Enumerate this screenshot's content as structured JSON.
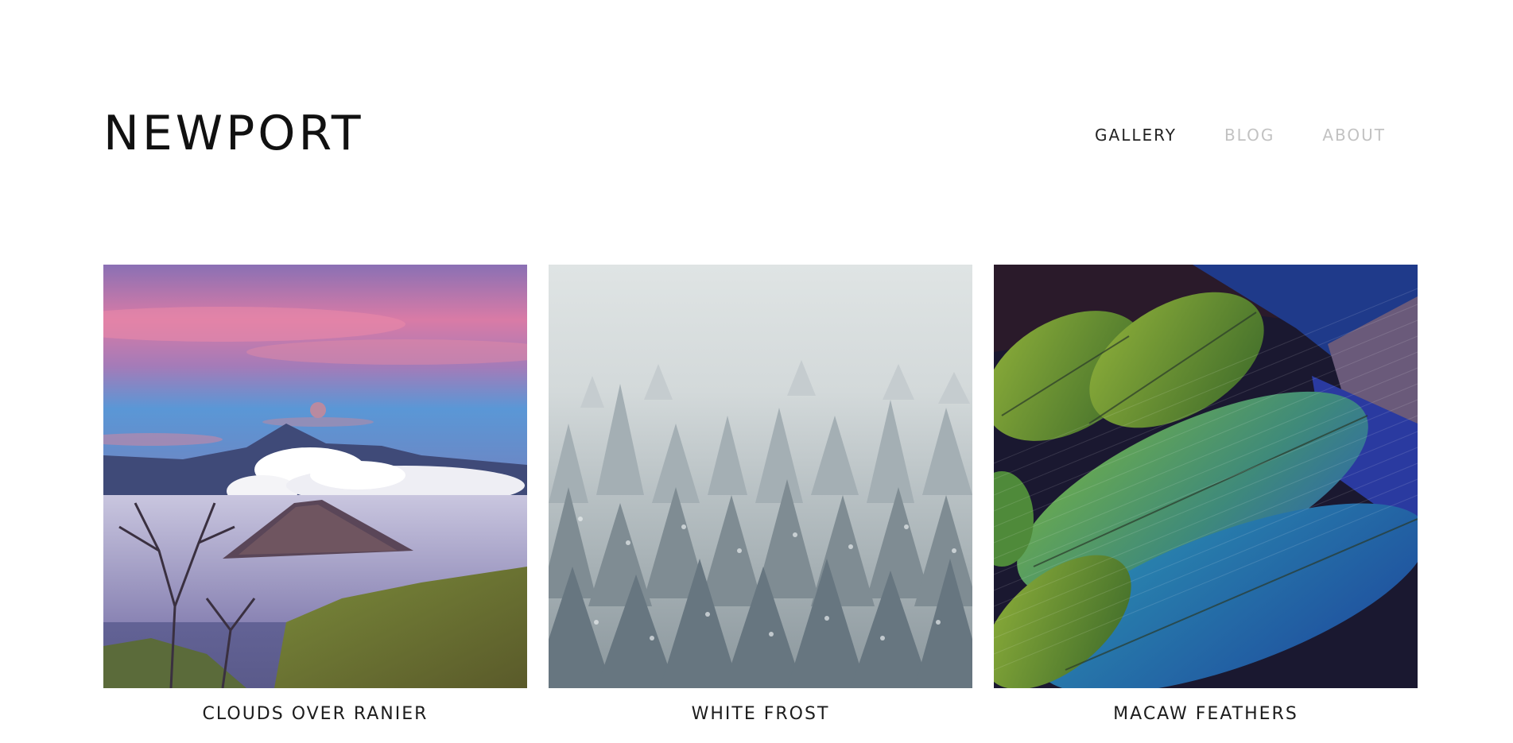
{
  "header": {
    "brand": "NEWPORT",
    "nav": [
      {
        "label": "GALLERY",
        "active": true
      },
      {
        "label": "BLOG",
        "active": false
      },
      {
        "label": "ABOUT",
        "active": false
      }
    ]
  },
  "gallery": {
    "items": [
      {
        "caption": "CLOUDS OVER RANIER"
      },
      {
        "caption": "WHITE FROST"
      },
      {
        "caption": "MACAW FEATHERS"
      }
    ]
  },
  "colors": {
    "text_primary": "#111111",
    "nav_inactive": "#c2c2c2",
    "background": "#ffffff"
  }
}
